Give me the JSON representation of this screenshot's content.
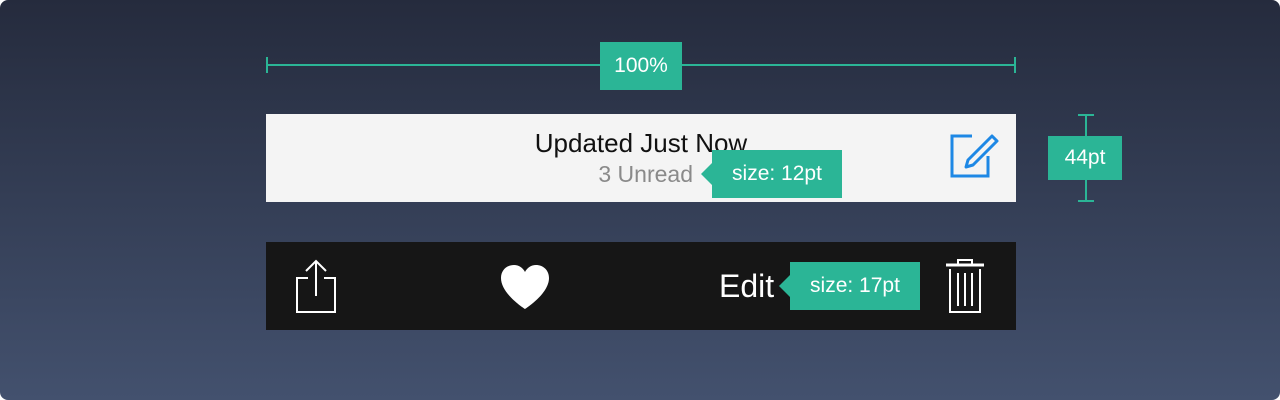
{
  "dimensions": {
    "width_label": "100%",
    "height_label": "44pt"
  },
  "navbar": {
    "title": "Updated Just Now",
    "subtitle": "3 Unread",
    "subtitle_size_label": "size: 12pt",
    "compose_icon": "compose-icon"
  },
  "toolbar": {
    "share_icon": "share-icon",
    "heart_icon": "heart-icon",
    "edit_label": "Edit",
    "edit_size_label": "size: 17pt",
    "trash_icon": "trash-icon"
  },
  "colors": {
    "accent": "#2bb596",
    "compose_blue": "#1e88e5",
    "navbar_bg": "#f4f4f4",
    "toolbar_bg": "#161616"
  }
}
